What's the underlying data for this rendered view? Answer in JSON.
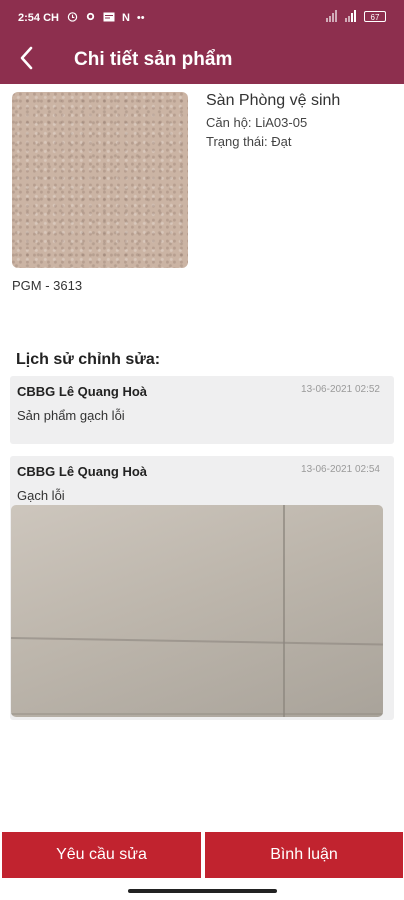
{
  "status_bar": {
    "time": "2:54 CH",
    "icons": [
      "alarm-icon",
      "settings-icon",
      "message-icon",
      "n-icon",
      "more-icon"
    ],
    "more": "••",
    "battery": "67"
  },
  "header": {
    "title": "Chi tiết sản phẩm"
  },
  "product": {
    "name": "Sàn Phòng vệ sinh",
    "apartment": "Căn hộ: LiA03-05",
    "status": "Trạng thái: Đạt",
    "code": "PGM - 3613"
  },
  "history": {
    "title": "Lịch sử chỉnh sửa:",
    "entries": [
      {
        "author": "CBBG Lê Quang Hoà",
        "date": "13-06-2021 02:52",
        "message": "Sản phẩm gạch lỗi"
      },
      {
        "author": "CBBG Lê Quang Hoà",
        "date": "13-06-2021 02:54",
        "message": "Gạch lỗi"
      }
    ]
  },
  "actions": {
    "request_fix": "Yêu cầu sửa",
    "comment": "Bình luận"
  },
  "colors": {
    "header": "#8d2f4e",
    "button": "#c1232f",
    "card": "#efeff0"
  }
}
